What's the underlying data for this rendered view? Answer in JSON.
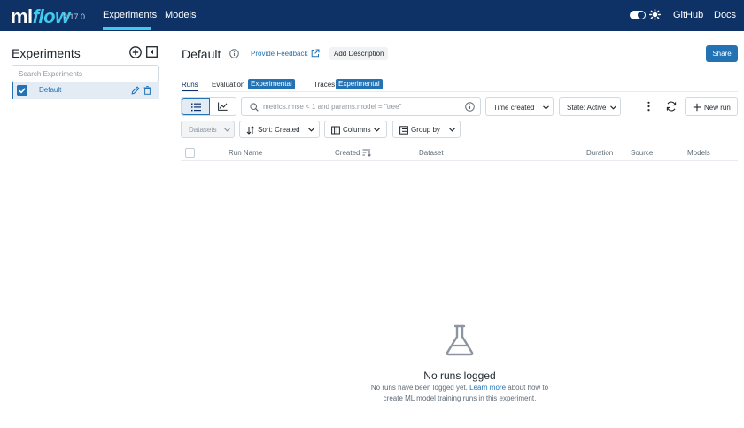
{
  "app": {
    "logo_ml": "ml",
    "logo_flow": "flow",
    "version": "2.17.0"
  },
  "nav": {
    "experiments": "Experiments",
    "models": "Models",
    "github": "GitHub",
    "docs": "Docs"
  },
  "sidebar": {
    "title": "Experiments",
    "search_placeholder": "Search Experiments",
    "items": [
      {
        "label": "Default",
        "selected": true
      }
    ]
  },
  "header": {
    "title": "Default",
    "feedback": "Provide Feedback",
    "add_description": "Add Description",
    "share": "Share"
  },
  "tabs": [
    {
      "label": "Runs",
      "active": true,
      "badge": ""
    },
    {
      "label": "Evaluation",
      "active": false,
      "badge": "Experimental"
    },
    {
      "label": "Traces",
      "active": false,
      "badge": "Experimental"
    }
  ],
  "toolbar": {
    "search_placeholder": "metrics.rmse < 1 and params.model = \"tree\"",
    "time_select": "Time created",
    "state_select": "State: Active",
    "new_run": "New run",
    "datasets": "Datasets",
    "sort": "Sort: Created",
    "columns": "Columns",
    "group_by": "Group by"
  },
  "table": {
    "columns": [
      "Run Name",
      "Created",
      "Dataset",
      "Duration",
      "Source",
      "Models"
    ]
  },
  "empty_state": {
    "title": "No runs logged",
    "desc_before": "No runs have been logged yet.",
    "link": "Learn more",
    "desc_after": "about how to create ML model training runs in this experiment."
  },
  "colors": {
    "topbar": "#0e3266",
    "accent": "#2272b4",
    "logo_flow": "#43c9ed"
  }
}
